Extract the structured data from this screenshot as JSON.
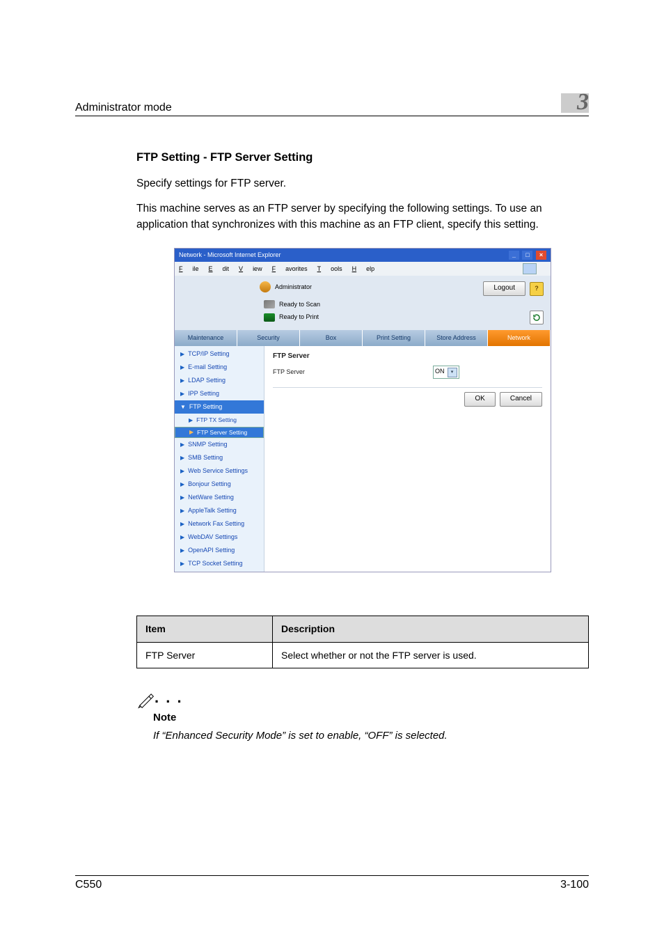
{
  "header": {
    "title": "Administrator mode",
    "chapter": "3"
  },
  "section": {
    "heading": "FTP Setting - FTP Server Setting",
    "p1": "Specify settings for FTP server.",
    "p2": "This machine serves as an FTP server by specifying the following settings. To use an application that synchronizes with this machine as an FTP client, specify this setting."
  },
  "browser": {
    "title": "Network - Microsoft Internet Explorer",
    "menus": [
      "File",
      "Edit",
      "View",
      "Favorites",
      "Tools",
      "Help"
    ],
    "adminLabel": "Administrator",
    "logout": "Logout",
    "help": "?",
    "status1": "Ready to Scan",
    "status2": "Ready to Print",
    "tabs": [
      "Maintenance",
      "Security",
      "Box",
      "Print Setting",
      "Store Address",
      "Network"
    ],
    "side": [
      {
        "label": "TCP/IP Setting"
      },
      {
        "label": "E-mail Setting"
      },
      {
        "label": "LDAP Setting"
      },
      {
        "label": "IPP Setting"
      },
      {
        "label": "FTP Setting",
        "open": true
      },
      {
        "label": "FTP TX Setting",
        "sub": true
      },
      {
        "label": "FTP Server Setting",
        "sub": true,
        "sel": true
      },
      {
        "label": "SNMP Setting"
      },
      {
        "label": "SMB Setting"
      },
      {
        "label": "Web Service Settings"
      },
      {
        "label": "Bonjour Setting"
      },
      {
        "label": "NetWare Setting"
      },
      {
        "label": "AppleTalk Setting"
      },
      {
        "label": "Network Fax Setting"
      },
      {
        "label": "WebDAV Settings"
      },
      {
        "label": "OpenAPI Setting"
      },
      {
        "label": "TCP Socket Setting"
      }
    ],
    "panelTitle": "FTP Server",
    "fieldLabel": "FTP Server",
    "fieldValue": "ON",
    "ok": "OK",
    "cancel": "Cancel"
  },
  "descTable": {
    "h1": "Item",
    "h2": "Description",
    "r1c1": "FTP Server",
    "r1c2": "Select whether or not the FTP server is used."
  },
  "note": {
    "label": "Note",
    "text": "If “Enhanced Security Mode” is set to enable, “OFF” is selected."
  },
  "footer": {
    "left": "C550",
    "right": "3-100"
  }
}
